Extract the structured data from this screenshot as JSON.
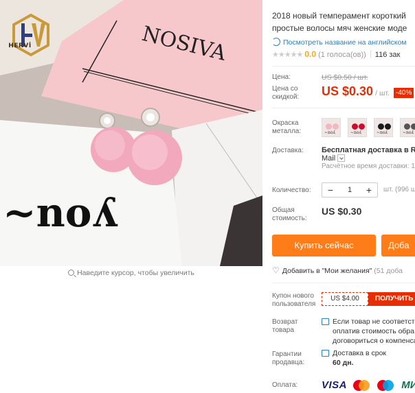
{
  "product": {
    "title_line1": "2018 новый темперамент короткий",
    "title_line2": "простые волосы мяч женские моде",
    "english_link": "Посмотреть название на английском",
    "rating": {
      "stars": "★★★★★",
      "score": "0.0",
      "votes": "(1 голоса(ов))",
      "orders": "116 зак"
    }
  },
  "gallery": {
    "logo_text": "HERVİ",
    "zoom_hint": "Наведите курсор, чтобы увеличить",
    "photo_text_top": "NOSIVA",
    "photo_text_card": "~noʎ"
  },
  "price": {
    "label": "Цена:",
    "old": "US $0.50 / шт.",
    "sale_label": "Цена со скидкой:",
    "new": "US $0.30",
    "unit": "/ шт.",
    "discount": "-40%"
  },
  "color": {
    "label": "Окраска металла:",
    "swatches": [
      {
        "name": "pink",
        "ball": "#f2b7c7"
      },
      {
        "name": "red",
        "ball": "#c8102e"
      },
      {
        "name": "black",
        "ball": "#1a1a1a"
      },
      {
        "name": "grey",
        "ball": "#555555"
      }
    ],
    "swatch_text": "~noʎ"
  },
  "shipping": {
    "label": "Доставка:",
    "main": "Бесплатная доставка в Rus",
    "service": "Mail",
    "time": "Расчётное время доставки: 1"
  },
  "quantity": {
    "label": "Количество:",
    "value": "1",
    "minus": "−",
    "plus": "+",
    "stock": "шт. (996 ш"
  },
  "total": {
    "label": "Общая стоимость:",
    "value": "US $0.30"
  },
  "actions": {
    "buy": "Купить сейчас",
    "cart": "Доба"
  },
  "wishlist": {
    "text": "Добавить в \"Мои желания\"",
    "count": "(51 доба"
  },
  "coupon": {
    "label": "Купон нового пользователя",
    "value": "US $4.00",
    "button": "ПОЛУЧИТЬ"
  },
  "returns": {
    "label": "Возврат товара",
    "text": "Если товар не соответстве оплатив стоимость обра договориться о компенса"
  },
  "guarantee": {
    "label": "Гарантии продавца:",
    "line1": "Доставка в срок",
    "line2": "60 дн."
  },
  "payment": {
    "label": "Оплата:",
    "visa": "VISA",
    "mir": "МИ"
  },
  "colors": {
    "accent": "#e62e04",
    "button": "#ff7d19",
    "link": "#2a7fbe",
    "rating": "#f5a623"
  }
}
